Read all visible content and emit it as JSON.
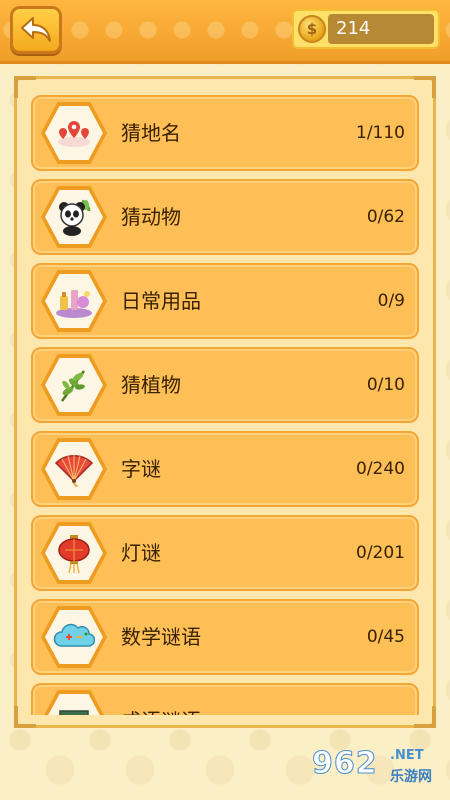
{
  "header": {
    "coin_count": "214"
  },
  "categories": [
    {
      "title": "猜地名",
      "progress": "1/110",
      "icon": "map-pin-icon"
    },
    {
      "title": "猜动物",
      "progress": "0/62",
      "icon": "panda-icon"
    },
    {
      "title": "日常用品",
      "progress": "0/9",
      "icon": "household-items-icon"
    },
    {
      "title": "猜植物",
      "progress": "0/10",
      "icon": "plant-icon"
    },
    {
      "title": "字谜",
      "progress": "0/240",
      "icon": "folding-fan-icon"
    },
    {
      "title": "灯谜",
      "progress": "0/201",
      "icon": "lantern-icon"
    },
    {
      "title": "数学谜语",
      "progress": "0/45",
      "icon": "math-cloud-icon"
    },
    {
      "title": "成语谜语",
      "progress": "",
      "icon": "idiom-icon"
    }
  ],
  "watermark": {
    "number": "962",
    "suffix": ".NET",
    "site": "乐游网"
  },
  "colors": {
    "header": "#f4a629",
    "row": "#fdbf56",
    "panel": "#fde7ad",
    "text": "#3a2100"
  }
}
